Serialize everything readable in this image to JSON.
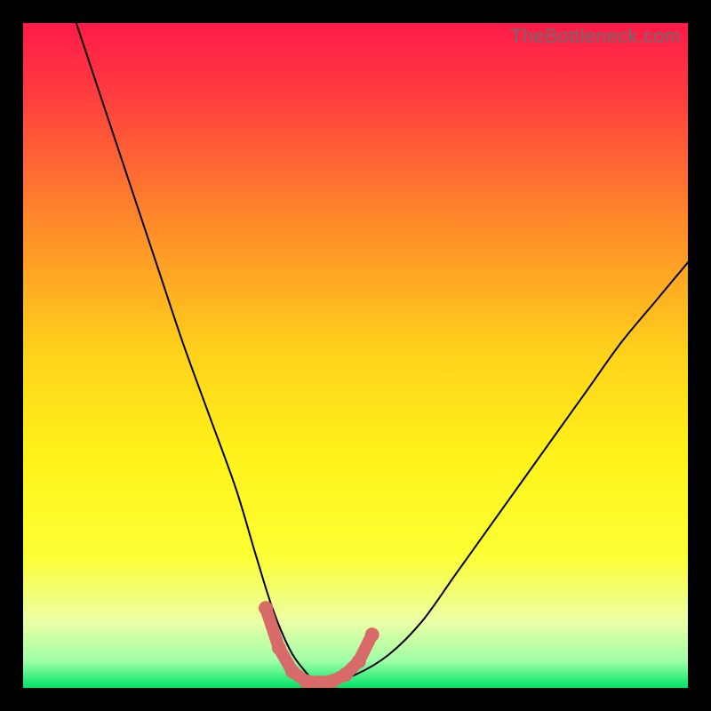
{
  "watermark": "TheBottleneck.com",
  "colors": {
    "frame": "#000000",
    "curve_stroke": "#000000",
    "highlight_stroke": "#d86a6a",
    "gradient_stops": [
      {
        "offset": 0.0,
        "color": "#ff1a49"
      },
      {
        "offset": 0.1,
        "color": "#ff3a40"
      },
      {
        "offset": 0.3,
        "color": "#ff8a2a"
      },
      {
        "offset": 0.5,
        "color": "#ffd31a"
      },
      {
        "offset": 0.65,
        "color": "#fff21a"
      },
      {
        "offset": 0.8,
        "color": "#fcff33"
      },
      {
        "offset": 0.9,
        "color": "#ecffa6"
      },
      {
        "offset": 0.96,
        "color": "#9effa6"
      },
      {
        "offset": 1.0,
        "color": "#00e268"
      }
    ]
  },
  "chart_data": {
    "type": "line",
    "title": "",
    "xlabel": "",
    "ylabel": "",
    "xlim": [
      0,
      100
    ],
    "ylim": [
      0,
      100
    ],
    "grid": false,
    "series": [
      {
        "name": "bottleneck-curve",
        "x": [
          8,
          12,
          16,
          20,
          24,
          28,
          32,
          35,
          37.5,
          40,
          42,
          44,
          46,
          50,
          55,
          60,
          65,
          70,
          75,
          80,
          85,
          90,
          95,
          100
        ],
        "y": [
          100,
          88,
          76,
          64,
          52,
          41,
          30,
          20,
          12,
          6,
          3,
          1,
          1,
          2,
          5,
          10,
          17,
          24,
          31,
          38,
          45,
          52,
          58,
          64
        ]
      }
    ],
    "highlight_segment": {
      "name": "valley-highlight",
      "points": [
        {
          "x": 36.5,
          "y": 12
        },
        {
          "x": 38.5,
          "y": 6
        },
        {
          "x": 40.5,
          "y": 2.5
        },
        {
          "x": 42.5,
          "y": 1
        },
        {
          "x": 44.5,
          "y": 0.8
        },
        {
          "x": 46.5,
          "y": 1
        },
        {
          "x": 48.5,
          "y": 2
        },
        {
          "x": 50.5,
          "y": 4
        },
        {
          "x": 52.5,
          "y": 8
        }
      ]
    }
  }
}
